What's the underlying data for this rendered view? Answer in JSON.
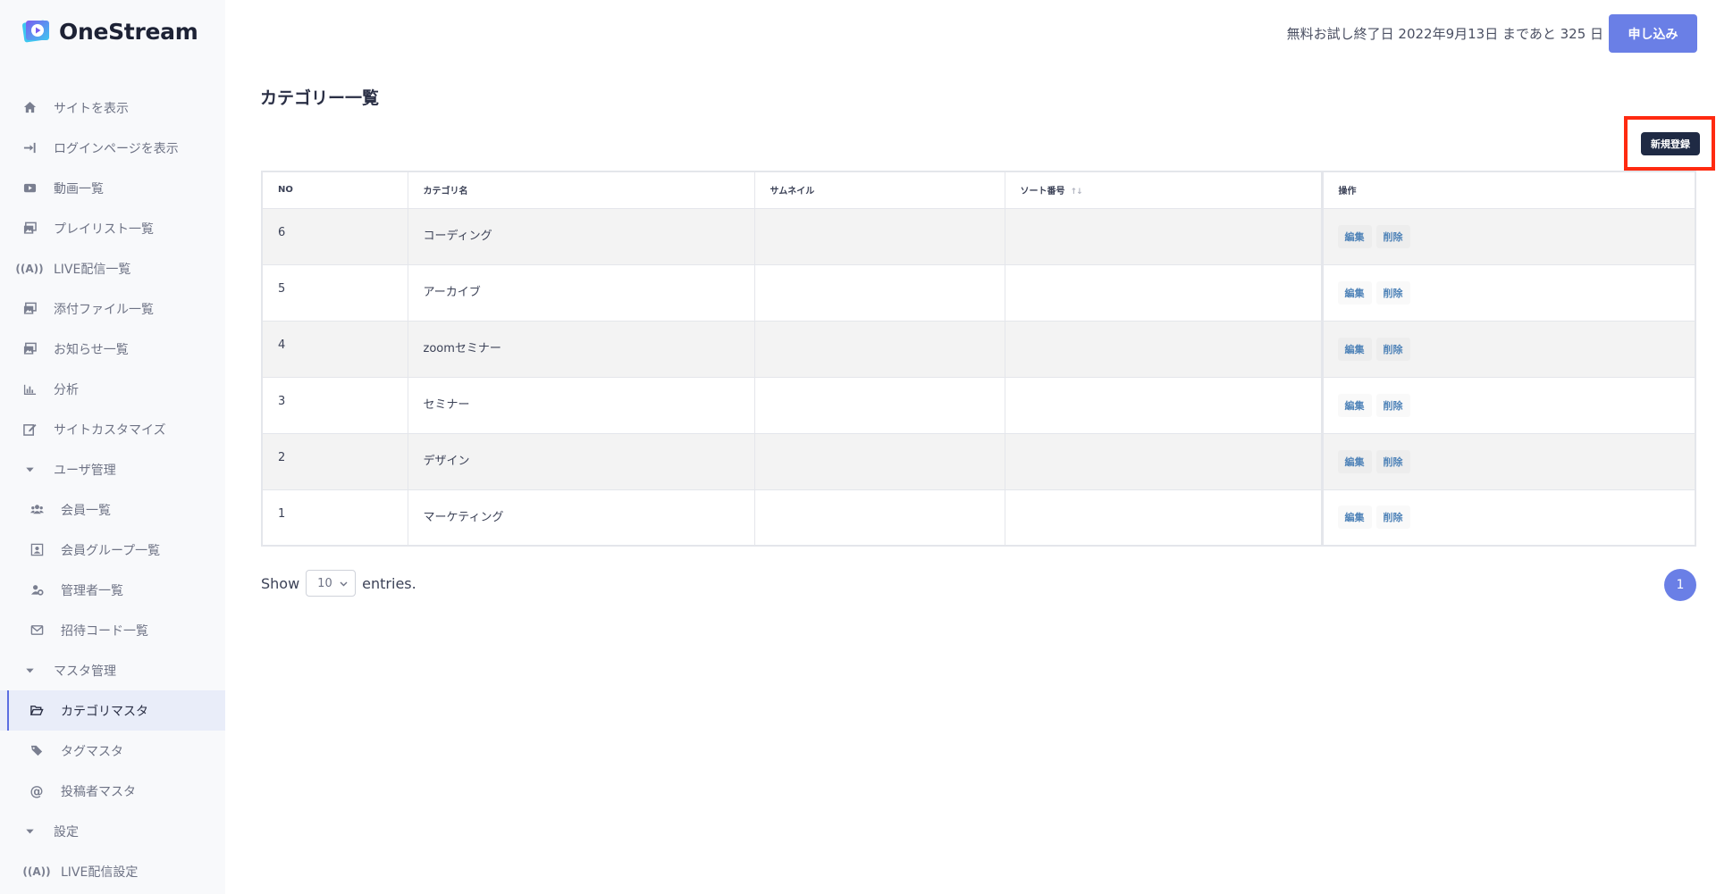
{
  "app": {
    "name": "OneStream"
  },
  "header": {
    "trial_text": "無料お試し終了日 2022年9月13日 まであと 325 日",
    "apply_label": "申し込み"
  },
  "sidebar": {
    "items": [
      {
        "label": "サイトを表示",
        "icon": "home-icon"
      },
      {
        "label": "ログインページを表示",
        "icon": "sign-in-icon"
      },
      {
        "label": "動画一覧",
        "icon": "video-icon"
      },
      {
        "label": "プレイリスト一覧",
        "icon": "images-icon"
      },
      {
        "label": "LIVE配信一覧",
        "icon": "broadcast-icon"
      },
      {
        "label": "添付ファイル一覧",
        "icon": "images-icon"
      },
      {
        "label": "お知らせ一覧",
        "icon": "images-icon"
      },
      {
        "label": "分析",
        "icon": "bar-chart-icon"
      },
      {
        "label": "サイトカスタマイズ",
        "icon": "edit-icon"
      },
      {
        "label": "ユーザ管理",
        "icon": "caret-down-icon"
      },
      {
        "label": "会員一覧",
        "icon": "users-icon"
      },
      {
        "label": "会員グループ一覧",
        "icon": "group-icon"
      },
      {
        "label": "管理者一覧",
        "icon": "users-cog-icon"
      },
      {
        "label": "招待コード一覧",
        "icon": "envelope-icon"
      },
      {
        "label": "マスタ管理",
        "icon": "caret-down-icon"
      },
      {
        "label": "カテゴリマスタ",
        "icon": "folder-open-icon"
      },
      {
        "label": "タグマスタ",
        "icon": "tags-icon"
      },
      {
        "label": "投稿者マスタ",
        "icon": "at-icon"
      },
      {
        "label": "設定",
        "icon": "caret-down-icon"
      },
      {
        "label": "LIVE配信設定",
        "icon": "broadcast-icon"
      }
    ]
  },
  "main": {
    "title": "カテゴリー一覧",
    "new_label": "新規登録",
    "table": {
      "headers": [
        "NO",
        "カテゴリ名",
        "サムネイル",
        "ソート番号",
        "操作"
      ],
      "sort_arrows": "↑↓",
      "rows": [
        {
          "no": "6",
          "name": "コーディング",
          "thumbnail": "",
          "sort": ""
        },
        {
          "no": "5",
          "name": "アーカイブ",
          "thumbnail": "",
          "sort": ""
        },
        {
          "no": "4",
          "name": "zoomセミナー",
          "thumbnail": "",
          "sort": ""
        },
        {
          "no": "3",
          "name": "セミナー",
          "thumbnail": "",
          "sort": ""
        },
        {
          "no": "2",
          "name": "デザイン",
          "thumbnail": "",
          "sort": ""
        },
        {
          "no": "1",
          "name": "マーケティング",
          "thumbnail": "",
          "sort": ""
        }
      ],
      "edit_label": "編集",
      "delete_label": "削除"
    },
    "show_label": "Show",
    "entries_label": "entries.",
    "page_size": "10",
    "current_page": "1"
  },
  "colors": {
    "accent": "#6a7fe6",
    "highlight": "#ff2a10",
    "dark_button": "#1f2a44",
    "action_text": "#4f83b8"
  }
}
